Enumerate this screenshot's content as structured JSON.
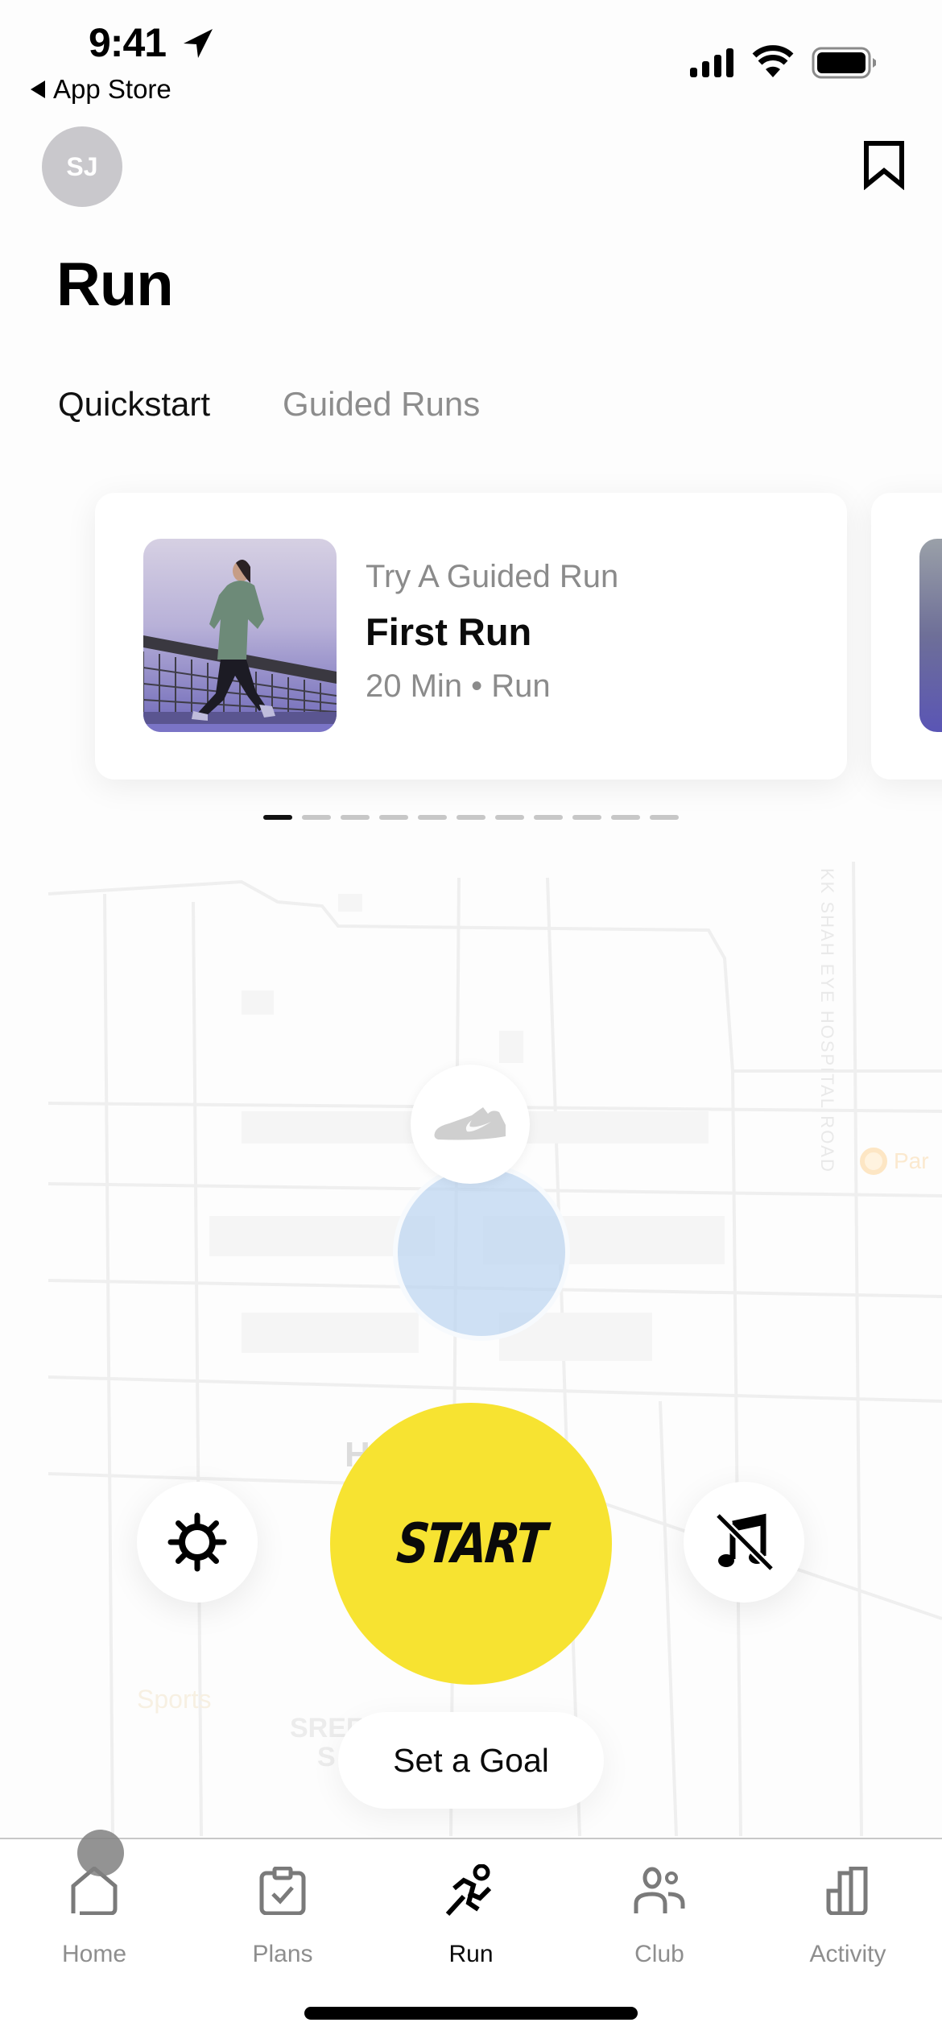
{
  "status_bar": {
    "time": "9:41",
    "back_label": "App Store",
    "icons": [
      "location-arrow-icon",
      "cellular-signal-icon",
      "wifi-icon",
      "battery-icon"
    ]
  },
  "header": {
    "avatar_initials": "SJ",
    "bookmark_icon": "bookmark-icon",
    "title": "Run"
  },
  "tabs": [
    {
      "label": "Quickstart",
      "active": true
    },
    {
      "label": "Guided Runs",
      "active": false
    }
  ],
  "carousel": {
    "cards": [
      {
        "eyebrow": "Try A Guided Run",
        "title": "First Run",
        "meta": "20 Min • Run",
        "image": "runner-photo"
      }
    ],
    "page_count": 11,
    "active_page": 1
  },
  "map": {
    "road_label": "KK SHAH EYE HOSPITAL ROAD",
    "poi_label": "Par",
    "label_h": "H",
    "label_sports": "Sports",
    "label_sref": "SREF",
    "label_s": "S",
    "accuracy_color": "#bed6f0"
  },
  "controls": {
    "settings_icon": "gear-icon",
    "start_label": "START",
    "music_icon": "music-off-icon",
    "goal_label": "Set a Goal",
    "start_color": "#f7e331"
  },
  "tab_bar": {
    "items": [
      {
        "label": "Home",
        "icon": "home-icon",
        "active": false
      },
      {
        "label": "Plans",
        "icon": "clipboard-check-icon",
        "active": false
      },
      {
        "label": "Run",
        "icon": "runner-icon",
        "active": true
      },
      {
        "label": "Club",
        "icon": "people-icon",
        "active": false
      },
      {
        "label": "Activity",
        "icon": "bar-chart-icon",
        "active": false
      }
    ]
  }
}
